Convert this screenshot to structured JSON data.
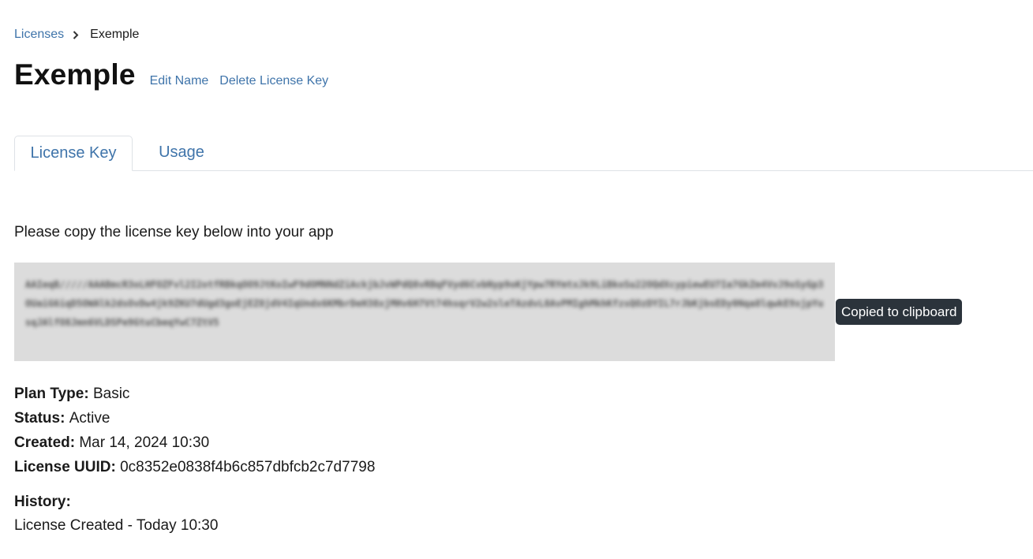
{
  "breadcrumb": {
    "parent_label": "Licenses",
    "current_label": "Exemple"
  },
  "header": {
    "title": "Exemple",
    "edit_name_label": "Edit Name",
    "delete_label": "Delete License Key"
  },
  "tabs": [
    {
      "label": "License Key",
      "active": true
    },
    {
      "label": "Usage",
      "active": false
    }
  ],
  "license": {
    "instruction": "Please copy the license key below into your app",
    "key_value": "AAIeqB/////AAABmcR3oLHFOZFvl2I2otfRBkqOO9JtKoIwF9dOMNNdZiAckjbJvWPdQ8vRBqFVyd6CvbNyp9oKjYpw7RYmtxJk9LiBkoSu22OQdXcypiewEU7Ia7GkZm4VvJ9oSyGp3OUaiG6iqD5OWAlk2dsOvDw4jk9ZKU7dUgd3goEjEZ8jdV4IqUndx6KMbrDeH38xjMHv6H7Vt74hsqrV2w2sleTAzdvL8AvPMIghMkhKfzsQOzDYIL7rJbKjbsEDy0Nqa8lqwkE9xjpYusqJAlfO8Jmn6VLDSPe9GtuCbeqYwC7ZtV5",
    "tooltip": "Copied to clipboard"
  },
  "details": {
    "plan_type": {
      "label": "Plan Type:",
      "value": "Basic"
    },
    "status": {
      "label": "Status:",
      "value": "Active"
    },
    "created": {
      "label": "Created:",
      "value": "Mar 14, 2024 10:30"
    },
    "uuid": {
      "label": "License UUID:",
      "value": "0c8352e0838f4b6c857dbfcb2c7d7798"
    }
  },
  "history": {
    "label": "History:",
    "entries": [
      "License Created - Today 10:30"
    ]
  },
  "colors": {
    "link": "#3f74aa",
    "tooltip_bg": "#2b333b",
    "key_box_bg": "#dcdcdc"
  }
}
